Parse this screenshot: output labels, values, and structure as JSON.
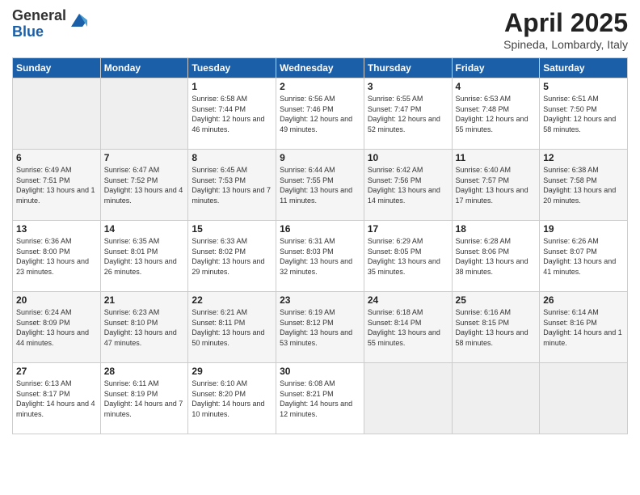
{
  "logo": {
    "general": "General",
    "blue": "Blue"
  },
  "header": {
    "month": "April 2025",
    "location": "Spineda, Lombardy, Italy"
  },
  "weekdays": [
    "Sunday",
    "Monday",
    "Tuesday",
    "Wednesday",
    "Thursday",
    "Friday",
    "Saturday"
  ],
  "weeks": [
    [
      {
        "day": "",
        "empty": true
      },
      {
        "day": "",
        "empty": true
      },
      {
        "day": "1",
        "sunrise": "6:58 AM",
        "sunset": "7:44 PM",
        "daylight": "12 hours and 46 minutes."
      },
      {
        "day": "2",
        "sunrise": "6:56 AM",
        "sunset": "7:46 PM",
        "daylight": "12 hours and 49 minutes."
      },
      {
        "day": "3",
        "sunrise": "6:55 AM",
        "sunset": "7:47 PM",
        "daylight": "12 hours and 52 minutes."
      },
      {
        "day": "4",
        "sunrise": "6:53 AM",
        "sunset": "7:48 PM",
        "daylight": "12 hours and 55 minutes."
      },
      {
        "day": "5",
        "sunrise": "6:51 AM",
        "sunset": "7:50 PM",
        "daylight": "12 hours and 58 minutes."
      }
    ],
    [
      {
        "day": "6",
        "sunrise": "6:49 AM",
        "sunset": "7:51 PM",
        "daylight": "13 hours and 1 minute."
      },
      {
        "day": "7",
        "sunrise": "6:47 AM",
        "sunset": "7:52 PM",
        "daylight": "13 hours and 4 minutes."
      },
      {
        "day": "8",
        "sunrise": "6:45 AM",
        "sunset": "7:53 PM",
        "daylight": "13 hours and 7 minutes."
      },
      {
        "day": "9",
        "sunrise": "6:44 AM",
        "sunset": "7:55 PM",
        "daylight": "13 hours and 11 minutes."
      },
      {
        "day": "10",
        "sunrise": "6:42 AM",
        "sunset": "7:56 PM",
        "daylight": "13 hours and 14 minutes."
      },
      {
        "day": "11",
        "sunrise": "6:40 AM",
        "sunset": "7:57 PM",
        "daylight": "13 hours and 17 minutes."
      },
      {
        "day": "12",
        "sunrise": "6:38 AM",
        "sunset": "7:58 PM",
        "daylight": "13 hours and 20 minutes."
      }
    ],
    [
      {
        "day": "13",
        "sunrise": "6:36 AM",
        "sunset": "8:00 PM",
        "daylight": "13 hours and 23 minutes."
      },
      {
        "day": "14",
        "sunrise": "6:35 AM",
        "sunset": "8:01 PM",
        "daylight": "13 hours and 26 minutes."
      },
      {
        "day": "15",
        "sunrise": "6:33 AM",
        "sunset": "8:02 PM",
        "daylight": "13 hours and 29 minutes."
      },
      {
        "day": "16",
        "sunrise": "6:31 AM",
        "sunset": "8:03 PM",
        "daylight": "13 hours and 32 minutes."
      },
      {
        "day": "17",
        "sunrise": "6:29 AM",
        "sunset": "8:05 PM",
        "daylight": "13 hours and 35 minutes."
      },
      {
        "day": "18",
        "sunrise": "6:28 AM",
        "sunset": "8:06 PM",
        "daylight": "13 hours and 38 minutes."
      },
      {
        "day": "19",
        "sunrise": "6:26 AM",
        "sunset": "8:07 PM",
        "daylight": "13 hours and 41 minutes."
      }
    ],
    [
      {
        "day": "20",
        "sunrise": "6:24 AM",
        "sunset": "8:09 PM",
        "daylight": "13 hours and 44 minutes."
      },
      {
        "day": "21",
        "sunrise": "6:23 AM",
        "sunset": "8:10 PM",
        "daylight": "13 hours and 47 minutes."
      },
      {
        "day": "22",
        "sunrise": "6:21 AM",
        "sunset": "8:11 PM",
        "daylight": "13 hours and 50 minutes."
      },
      {
        "day": "23",
        "sunrise": "6:19 AM",
        "sunset": "8:12 PM",
        "daylight": "13 hours and 53 minutes."
      },
      {
        "day": "24",
        "sunrise": "6:18 AM",
        "sunset": "8:14 PM",
        "daylight": "13 hours and 55 minutes."
      },
      {
        "day": "25",
        "sunrise": "6:16 AM",
        "sunset": "8:15 PM",
        "daylight": "13 hours and 58 minutes."
      },
      {
        "day": "26",
        "sunrise": "6:14 AM",
        "sunset": "8:16 PM",
        "daylight": "14 hours and 1 minute."
      }
    ],
    [
      {
        "day": "27",
        "sunrise": "6:13 AM",
        "sunset": "8:17 PM",
        "daylight": "14 hours and 4 minutes."
      },
      {
        "day": "28",
        "sunrise": "6:11 AM",
        "sunset": "8:19 PM",
        "daylight": "14 hours and 7 minutes."
      },
      {
        "day": "29",
        "sunrise": "6:10 AM",
        "sunset": "8:20 PM",
        "daylight": "14 hours and 10 minutes."
      },
      {
        "day": "30",
        "sunrise": "6:08 AM",
        "sunset": "8:21 PM",
        "daylight": "14 hours and 12 minutes."
      },
      {
        "day": "",
        "empty": true
      },
      {
        "day": "",
        "empty": true
      },
      {
        "day": "",
        "empty": true
      }
    ]
  ]
}
